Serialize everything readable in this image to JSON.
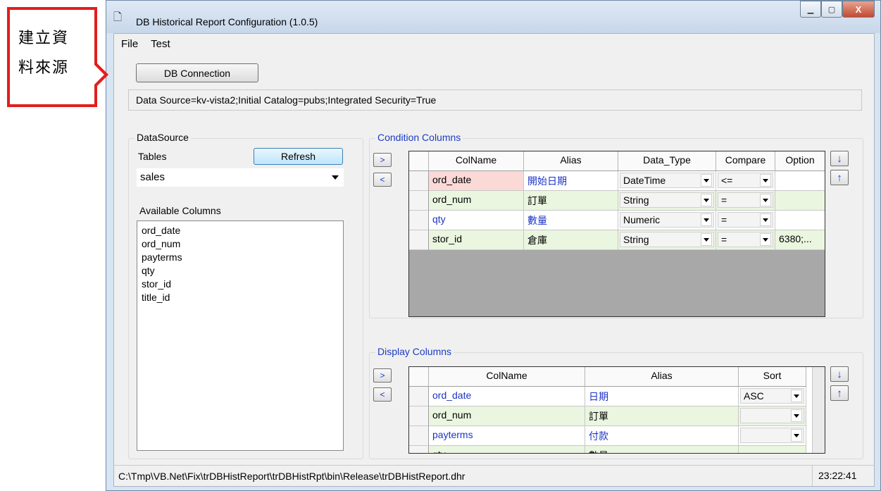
{
  "annotation": {
    "text": "建立資料來源",
    "line1": "建立資",
    "line2": "料來源",
    "color": "#e21e1e"
  },
  "window": {
    "title": "DB Historical Report Configuration (1.0.5)",
    "buttons": {
      "minimize": "▁",
      "maximize": "▢",
      "close": "X"
    }
  },
  "menu": {
    "items": [
      "File",
      "Test"
    ]
  },
  "db_connection": {
    "button_label": "DB Connection",
    "connection_string": "Data Source=kv-vista2;Initial Catalog=pubs;Integrated Security=True"
  },
  "datasource": {
    "group_label": "DataSource",
    "tables_label": "Tables",
    "refresh_label": "Refresh",
    "selected_table": "sales",
    "available_label": "Available Columns",
    "columns": [
      "ord_date",
      "ord_num",
      "payterms",
      "qty",
      "stor_id",
      "title_id"
    ]
  },
  "condition_columns": {
    "group_label": "Condition Columns",
    "add_label": ">",
    "remove_label": "<",
    "up_label": "↓",
    "down_label": "↑",
    "headers": [
      "ColName",
      "Alias",
      "Data_Type",
      "Compare",
      "Option"
    ],
    "rows": [
      {
        "colname": "ord_date",
        "alias": "開始日期",
        "data_type": "DateTime",
        "compare": "<=",
        "option": ""
      },
      {
        "colname": "ord_num",
        "alias": "訂單",
        "data_type": "String",
        "compare": "=",
        "option": ""
      },
      {
        "colname": "qty",
        "alias": "數量",
        "data_type": "Numeric",
        "compare": "=",
        "option": ""
      },
      {
        "colname": "stor_id",
        "alias": "倉庫",
        "data_type": "String",
        "compare": "=",
        "option": "6380;..."
      }
    ]
  },
  "display_columns": {
    "group_label": "Display Columns",
    "add_label": ">",
    "remove_label": "<",
    "up_label": "↓",
    "down_label": "↑",
    "headers": [
      "ColName",
      "Alias",
      "Sort"
    ],
    "rows": [
      {
        "colname": "ord_date",
        "alias": "日期",
        "sort": "ASC"
      },
      {
        "colname": "ord_num",
        "alias": "訂單",
        "sort": ""
      },
      {
        "colname": "payterms",
        "alias": "付款",
        "sort": ""
      },
      {
        "colname": "qty",
        "alias": "數量",
        "sort": ""
      }
    ]
  },
  "status": {
    "path": "C:\\Tmp\\VB.Net\\Fix\\trDBHistReport\\trDBHistRpt\\bin\\Release\\trDBHistReport.dhr",
    "time": "23:22:41"
  }
}
